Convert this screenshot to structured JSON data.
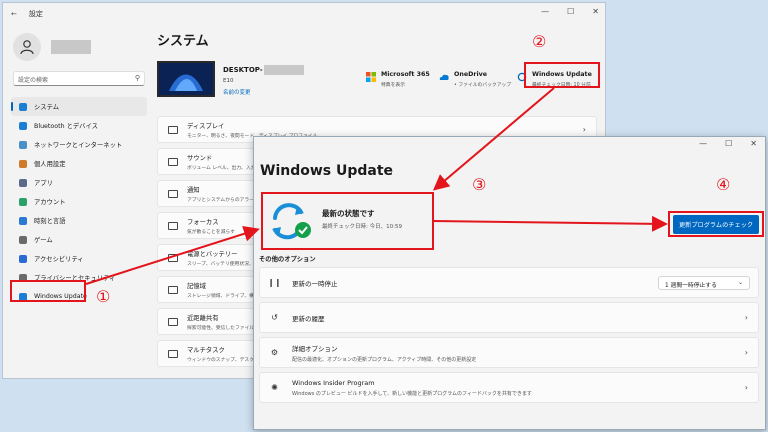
{
  "settings": {
    "window_title": "設定",
    "back_glyph": "←",
    "search_placeholder": "設定の検索",
    "page_title": "システム",
    "device": {
      "name_prefix": "DESKTOP-",
      "edition": "E10",
      "rename_link": "名前の変更"
    },
    "services": [
      {
        "title": "Microsoft 365",
        "sub": "特典を表示"
      },
      {
        "title": "OneDrive",
        "sub": "• ファイルのバックアップ"
      },
      {
        "title": "Windows Update",
        "sub": "最終チェック日時: 10 分前"
      }
    ],
    "nav": [
      {
        "label": "システム",
        "color": "#1a7fd4"
      },
      {
        "label": "Bluetooth とデバイス",
        "color": "#1a7fd4"
      },
      {
        "label": "ネットワークとインターネット",
        "color": "#4a90c8"
      },
      {
        "label": "個人用設定",
        "color": "#d07a2a"
      },
      {
        "label": "アプリ",
        "color": "#5a6a8a"
      },
      {
        "label": "アカウント",
        "color": "#2aa06a"
      },
      {
        "label": "時刻と言語",
        "color": "#2a7ad4"
      },
      {
        "label": "ゲーム",
        "color": "#6a6a6a"
      },
      {
        "label": "アクセシビリティ",
        "color": "#2a6ad4"
      },
      {
        "label": "プライバシーとセキュリティ",
        "color": "#6a6a6a"
      },
      {
        "label": "Windows Update",
        "color": "#1a7fd4"
      }
    ],
    "cards": [
      {
        "title": "ディスプレイ",
        "sub": "モニター、明るさ、夜間モード、ディスプレイ プロファイル"
      },
      {
        "title": "サウンド",
        "sub": "ボリューム レベル、出力、入力、サウンド デバイス"
      },
      {
        "title": "通知",
        "sub": "アプリとシステムからのアラート"
      },
      {
        "title": "フォーカス",
        "sub": "気が散ることを減らす"
      },
      {
        "title": "電源とバッテリー",
        "sub": "スリープ、バッテリ使用状況、バッテリー節約機能"
      },
      {
        "title": "記憶域",
        "sub": "ストレージ領域、ドライブ、構成ルール"
      },
      {
        "title": "近距離共有",
        "sub": "探索可能性、受信したファイルの場所"
      },
      {
        "title": "マルチタスク",
        "sub": "ウィンドウのスナップ、デスクトップ、タスクの切り替え"
      }
    ]
  },
  "wu": {
    "title": "Windows Update",
    "status_title": "最新の状態です",
    "status_sub": "最終チェック日時: 今日、10:59",
    "check_button": "更新プログラムのチェック",
    "other_options_label": "その他のオプション",
    "options": [
      {
        "title": "更新の一時停止",
        "sub": "",
        "control": "1 週間一時停止する"
      },
      {
        "title": "更新の履歴",
        "sub": ""
      },
      {
        "title": "詳細オプション",
        "sub": "配信の最適化、オプションの更新プログラム、アクティブ時間、その他の更新設定"
      },
      {
        "title": "Windows Insider Program",
        "sub": "Windows のプレビュー ビルドを入手して、新しい機能と更新プログラムのフィードバックを共有できます"
      }
    ]
  },
  "annotations": [
    "①",
    "②",
    "③",
    "④"
  ]
}
